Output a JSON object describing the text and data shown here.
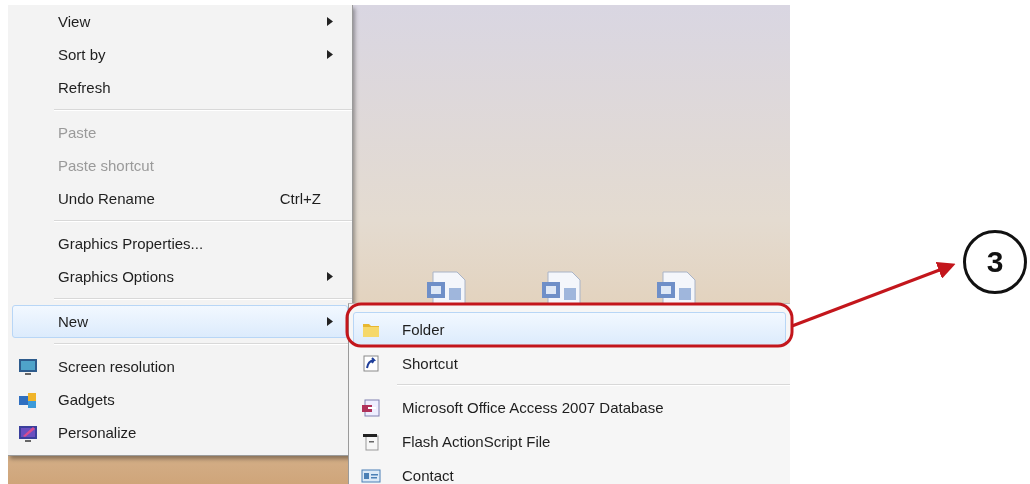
{
  "context_menu": {
    "items": [
      {
        "kind": "plain",
        "label": "View",
        "has_submenu": true,
        "disabled": false,
        "selected": false
      },
      {
        "kind": "plain",
        "label": "Sort by",
        "has_submenu": true,
        "disabled": false,
        "selected": false
      },
      {
        "kind": "plain",
        "label": "Refresh",
        "has_submenu": false,
        "disabled": false,
        "selected": false
      },
      {
        "kind": "separator"
      },
      {
        "kind": "plain",
        "label": "Paste",
        "has_submenu": false,
        "disabled": true,
        "selected": false
      },
      {
        "kind": "plain",
        "label": "Paste shortcut",
        "has_submenu": false,
        "disabled": true,
        "selected": false
      },
      {
        "kind": "plain",
        "label": "Undo Rename",
        "shortcut": "Ctrl+Z",
        "has_submenu": false,
        "disabled": false,
        "selected": false
      },
      {
        "kind": "separator"
      },
      {
        "kind": "plain",
        "label": "Graphics Properties...",
        "has_submenu": false,
        "disabled": false,
        "selected": false
      },
      {
        "kind": "plain",
        "label": "Graphics Options",
        "has_submenu": true,
        "disabled": false,
        "selected": false
      },
      {
        "kind": "separator"
      },
      {
        "kind": "plain",
        "label": "New",
        "has_submenu": true,
        "disabled": false,
        "selected": true
      },
      {
        "kind": "separator"
      },
      {
        "kind": "icon",
        "label": "Screen resolution",
        "has_submenu": false,
        "disabled": false,
        "selected": false
      },
      {
        "kind": "icon",
        "label": "Gadgets",
        "has_submenu": false,
        "disabled": false,
        "selected": false
      },
      {
        "kind": "icon",
        "label": "Personalize",
        "has_submenu": false,
        "disabled": false,
        "selected": false
      }
    ]
  },
  "new_submenu": {
    "items": [
      {
        "kind": "icon",
        "label": "Folder",
        "selected": true
      },
      {
        "kind": "icon",
        "label": "Shortcut",
        "selected": false
      },
      {
        "kind": "separator"
      },
      {
        "kind": "icon",
        "label": "Microsoft Office Access 2007 Database",
        "selected": false
      },
      {
        "kind": "icon",
        "label": "Flash ActionScript File",
        "selected": false
      },
      {
        "kind": "icon",
        "label": "Contact",
        "selected": false
      }
    ]
  },
  "annotation": {
    "step": "3"
  }
}
